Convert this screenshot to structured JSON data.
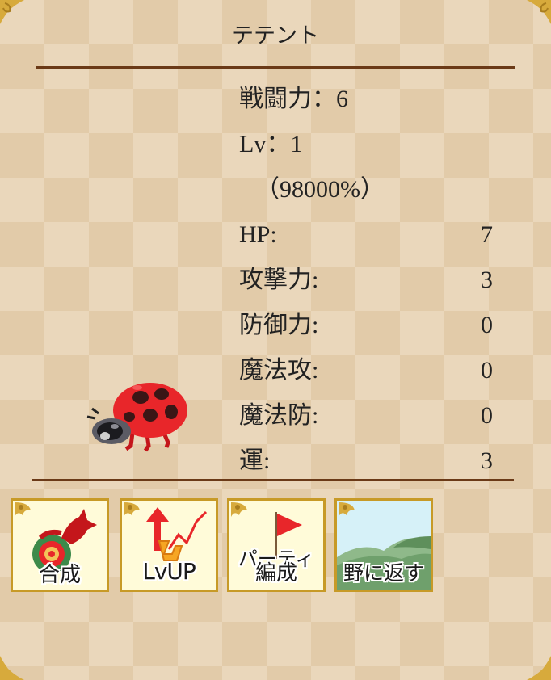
{
  "monster": {
    "name": "テテント"
  },
  "stats": {
    "power": "戦闘力：6",
    "level": "Lv：1",
    "exp": "（98000%）",
    "rows": [
      {
        "label": "HP:",
        "value": "7"
      },
      {
        "label": "攻撃力:",
        "value": "3"
      },
      {
        "label": "防御力:",
        "value": "0"
      },
      {
        "label": "魔法攻:",
        "value": "0"
      },
      {
        "label": "魔法防:",
        "value": "0"
      },
      {
        "label": "運:",
        "value": "3"
      }
    ]
  },
  "actions": {
    "fuse": {
      "label": "合成",
      "icon": "red-dragon-icon"
    },
    "levelup": {
      "label": "LvUP",
      "icon": "lv-up-arrow-icon"
    },
    "party": {
      "label_line1": "パーティ",
      "label_line2": "編成",
      "icon": "red-flag-icon"
    },
    "release": {
      "label": "野に返す",
      "icon": "hills-icon"
    }
  },
  "colors": {
    "rule": "#6b3a17",
    "button_border": "#c79a27",
    "button_bg": "#fffbd9",
    "release_bg": "#d6f1f8",
    "ladybug_red": "#e8262a"
  }
}
